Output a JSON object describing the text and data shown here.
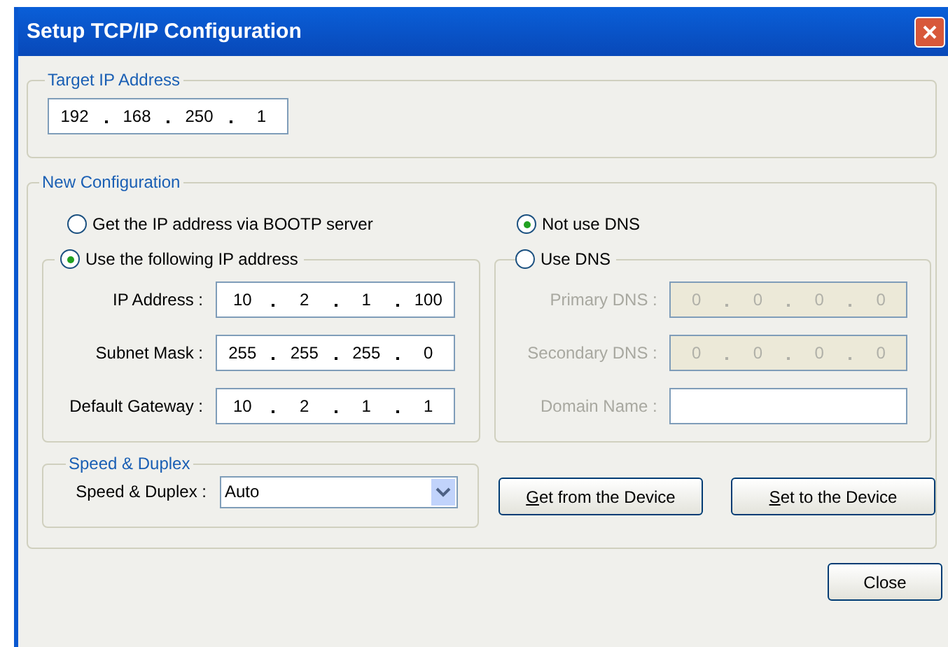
{
  "window": {
    "title": "Setup TCP/IP Configuration"
  },
  "target": {
    "legend": "Target IP Address",
    "ip": [
      "192",
      "168",
      "250",
      "1"
    ]
  },
  "new_config": {
    "legend": "New Configuration",
    "ip_mode": [
      {
        "label": "Get the IP address via BOOTP server",
        "selected": false
      },
      {
        "label": "Use the following IP address",
        "selected": true
      }
    ],
    "ip_fields": [
      {
        "label": "IP Address :",
        "octets": [
          "10",
          "2",
          "1",
          "100"
        ],
        "disabled": false
      },
      {
        "label": "Subnet Mask :",
        "octets": [
          "255",
          "255",
          "255",
          "0"
        ],
        "disabled": false
      },
      {
        "label": "Default Gateway :",
        "octets": [
          "10",
          "2",
          "1",
          "1"
        ],
        "disabled": false
      }
    ],
    "dns_mode": [
      {
        "label": "Not use DNS",
        "selected": true
      },
      {
        "label": "Use DNS",
        "selected": false
      }
    ],
    "dns_fields": [
      {
        "kind": "ip",
        "label": "Primary DNS :",
        "octets": [
          "0",
          "0",
          "0",
          "0"
        ],
        "disabled": true
      },
      {
        "kind": "ip",
        "label": "Secondary DNS :",
        "octets": [
          "0",
          "0",
          "0",
          "0"
        ],
        "disabled": true
      },
      {
        "kind": "text",
        "label": "Domain Name :",
        "disabled": true
      }
    ],
    "speed": {
      "legend": "Speed & Duplex",
      "label": "Speed & Duplex :",
      "value": "Auto"
    },
    "buttons": [
      {
        "mnemonic": "G",
        "rest": "et from the Device"
      },
      {
        "mnemonic": "S",
        "rest": "et to the Device"
      }
    ]
  },
  "footer": {
    "close": "Close"
  }
}
